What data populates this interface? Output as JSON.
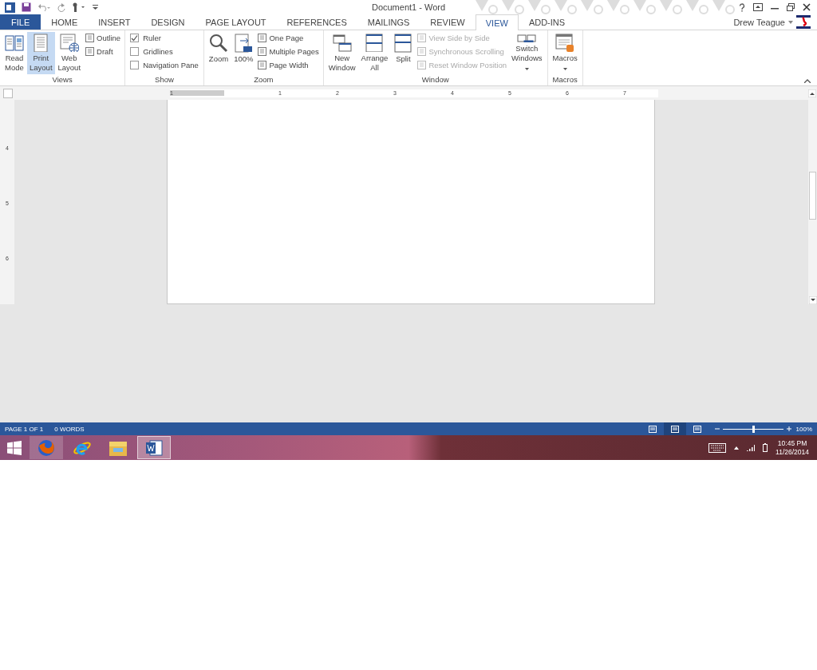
{
  "window": {
    "title": "Document1 - Word",
    "account": "Drew Teague"
  },
  "tabs": [
    {
      "label": "FILE",
      "kind": "file",
      "selected": false
    },
    {
      "label": "HOME",
      "kind": "tab",
      "selected": false
    },
    {
      "label": "INSERT",
      "kind": "tab",
      "selected": false
    },
    {
      "label": "DESIGN",
      "kind": "tab",
      "selected": false
    },
    {
      "label": "PAGE LAYOUT",
      "kind": "tab",
      "selected": false
    },
    {
      "label": "REFERENCES",
      "kind": "tab",
      "selected": false
    },
    {
      "label": "MAILINGS",
      "kind": "tab",
      "selected": false
    },
    {
      "label": "REVIEW",
      "kind": "tab",
      "selected": false
    },
    {
      "label": "VIEW",
      "kind": "tab",
      "selected": true
    },
    {
      "label": "ADD-INS",
      "kind": "tab",
      "selected": false
    }
  ],
  "ribbon": [
    {
      "label": "Views",
      "columns": [
        [
          {
            "kind": "large",
            "label": "Read Mode",
            "selected": false
          }
        ],
        [
          {
            "kind": "large",
            "label": "Print Layout",
            "selected": true
          }
        ],
        [
          {
            "kind": "large",
            "label": "Web Layout",
            "selected": false
          }
        ],
        [
          {
            "kind": "small",
            "label": "Outline",
            "disabled": false
          },
          {
            "kind": "small",
            "label": "Draft",
            "disabled": false
          }
        ]
      ]
    },
    {
      "label": "Show",
      "columns": [
        [
          {
            "kind": "check",
            "label": "Ruler",
            "checked": true
          },
          {
            "kind": "check",
            "label": "Gridlines",
            "checked": false
          },
          {
            "kind": "check",
            "label": "Navigation Pane",
            "checked": false
          }
        ]
      ]
    },
    {
      "label": "Zoom",
      "columns": [
        [
          {
            "kind": "large",
            "label": "Zoom",
            "selected": false
          }
        ],
        [
          {
            "kind": "large",
            "label": "100%",
            "selected": false
          }
        ],
        [
          {
            "kind": "small",
            "label": "One Page",
            "disabled": false
          },
          {
            "kind": "small",
            "label": "Multiple Pages",
            "disabled": false
          },
          {
            "kind": "small",
            "label": "Page Width",
            "disabled": false
          }
        ]
      ]
    },
    {
      "label": "Window",
      "columns": [
        [
          {
            "kind": "large",
            "label": "New Window",
            "selected": false
          }
        ],
        [
          {
            "kind": "large",
            "label": "Arrange All",
            "selected": false
          }
        ],
        [
          {
            "kind": "large",
            "label": "Split",
            "selected": false
          }
        ],
        [
          {
            "kind": "small",
            "label": "View Side by Side",
            "disabled": true
          },
          {
            "kind": "small",
            "label": "Synchronous Scrolling",
            "disabled": true
          },
          {
            "kind": "small",
            "label": "Reset Window Position",
            "disabled": true
          }
        ],
        [
          {
            "kind": "large",
            "label": "Switch Windows",
            "selected": false,
            "dropdown": true
          }
        ]
      ]
    },
    {
      "label": "Macros",
      "columns": [
        [
          {
            "kind": "large",
            "label": "Macros",
            "selected": false,
            "dropdown": true
          }
        ]
      ]
    }
  ],
  "ruler": {
    "horizontal": [
      "1",
      "1",
      "2",
      "3",
      "4",
      "5",
      "6",
      "7"
    ],
    "vertical": [
      "4",
      "5",
      "6"
    ]
  },
  "status_bar": {
    "page": "PAGE 1 OF 1",
    "words": "0 WORDS",
    "views": [
      {
        "selected": false
      },
      {
        "selected": true
      },
      {
        "selected": false
      }
    ],
    "zoom": {
      "level": 0.5,
      "reading": "100%"
    }
  },
  "taskbar": {
    "apps": [
      {
        "selected": false,
        "highlighted": true
      },
      {
        "selected": false,
        "highlighted": false
      },
      {
        "selected": false,
        "highlighted": false
      },
      {
        "selected": true,
        "highlighted": true
      }
    ],
    "time": "10:45 PM",
    "date": "11/26/2014"
  }
}
